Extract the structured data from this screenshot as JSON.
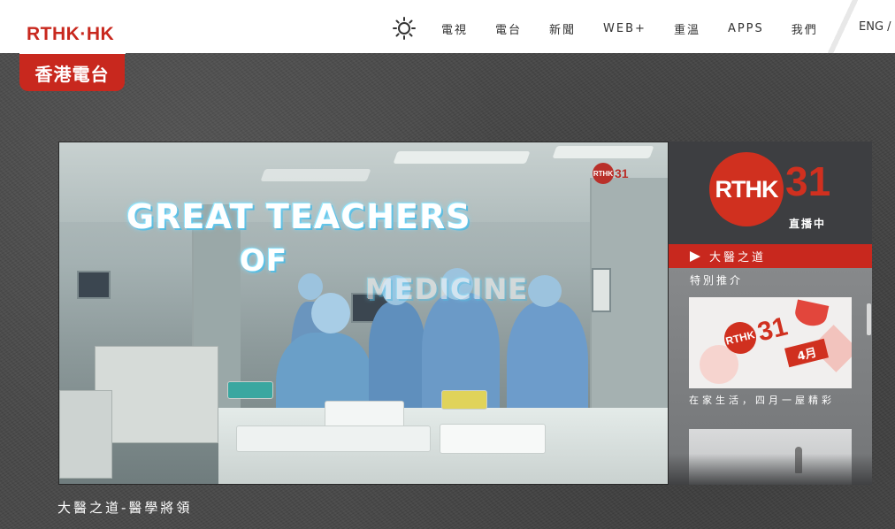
{
  "header": {
    "logo_text": "RTHK·HK",
    "logo_sub": "香港電台",
    "nav": [
      "電視",
      "電台",
      "新聞",
      "WEB+",
      "重溫",
      "APPS",
      "我們"
    ],
    "lang": "ENG /"
  },
  "video": {
    "title_line1": "GREAT TEACHERS",
    "title_line2": "OF",
    "title_line3": "MEDICINE",
    "watermark_logo": "RTHK",
    "watermark_num": "31",
    "caption": "大醫之道-醫學將領"
  },
  "side": {
    "channel_logo": "RTHK",
    "channel_num": "31",
    "live_label": "直播中",
    "now_playing": "大醫之道",
    "recommend_label": "特別推介",
    "card1": {
      "logo": "RTHK",
      "num": "31",
      "month": "4月",
      "caption": "在家生活，四月一屋精彩"
    }
  },
  "colors": {
    "brand_red": "#c8281e",
    "panel_dark": "#3a3b3d"
  }
}
